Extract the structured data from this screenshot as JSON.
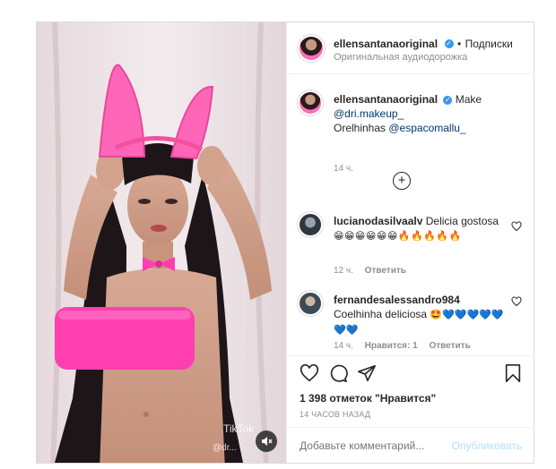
{
  "header": {
    "username": "ellensantanaoriginal",
    "separator": "•",
    "follow_label": "Подписки",
    "audio_label": "Оригинальная аудиодорожка"
  },
  "caption": {
    "username": "ellensantanaoriginal",
    "word": "Make",
    "line1": "@dri.makeup_",
    "line2_prefix": "Orelhinhas ",
    "line2_mention": "@espacomallu_",
    "time": "14 ч."
  },
  "load_more_symbol": "+",
  "comments": [
    {
      "username": "lucianodasilvaalv",
      "text": "Delicia gostosa",
      "emojis": "😁😁😁😁😁😁🔥🔥🔥🔥🔥",
      "time": "12 ч.",
      "likes": "",
      "reply": "Ответить"
    },
    {
      "username": "fernandesalessandro984",
      "text": "Coelhinha deliciosa",
      "emojis": "🤩💙💙💙💙💙💙💙",
      "time": "14 ч.",
      "likes": "Нравится: 1",
      "reply": "Ответить"
    }
  ],
  "likes_text": "1 398 отметок \"Нравится\"",
  "timestamp": "14 ЧАСОВ НАЗАД",
  "comment_placeholder": "Добавьте комментарий...",
  "publish_label": "Опубликовать",
  "video": {
    "watermark": "TikTok",
    "watermark_handle": "@dr..."
  },
  "colors": {
    "border": "#dbdbdb",
    "link": "#00376b",
    "accent": "#0095f6",
    "muted": "#8e8e8e",
    "top_pink": "#ff3fb0"
  },
  "icons": [
    "heart-icon",
    "comment-icon",
    "share-icon",
    "bookmark-icon",
    "mute-icon",
    "plus-circle-icon"
  ]
}
